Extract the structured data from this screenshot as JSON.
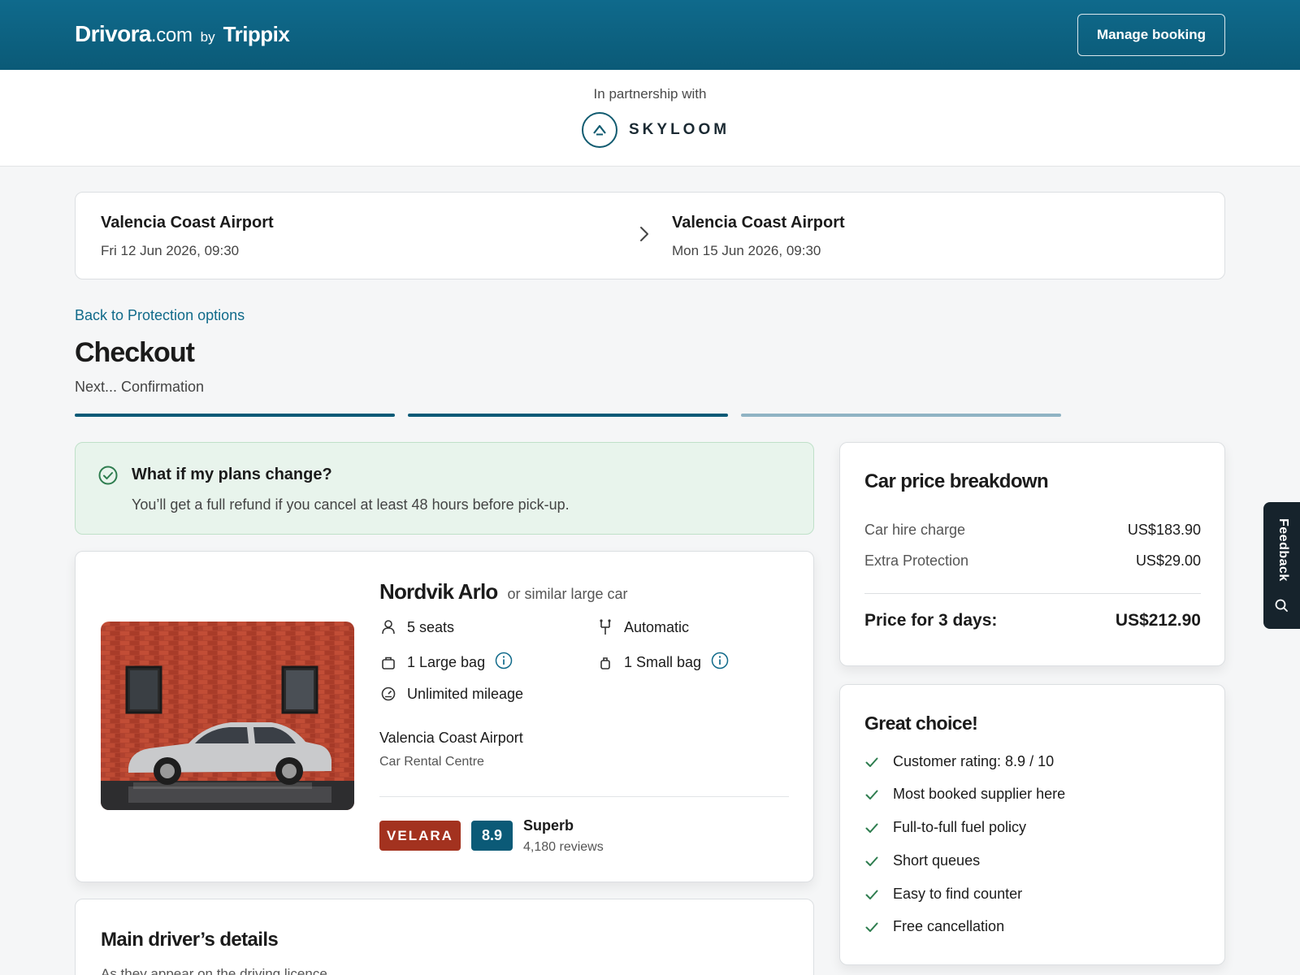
{
  "header": {
    "brand_main": "Drivora",
    "brand_domain": ".com",
    "brand_by": "by",
    "brand_partner": "Trippix",
    "manage_booking": "Manage booking"
  },
  "partnership": {
    "label": "In partnership with",
    "partner_name": "SKYLOOM"
  },
  "trip": {
    "pickup_location": "Valencia Coast Airport",
    "pickup_datetime": "Fri 12 Jun 2026, 09:30",
    "dropoff_location": "Valencia Coast Airport",
    "dropoff_datetime": "Mon 15 Jun 2026, 09:30"
  },
  "nav": {
    "back_link": "Back to Protection options"
  },
  "page": {
    "title": "Checkout",
    "next_step": "Next... Confirmation",
    "progress_steps": [
      {
        "state": "complete",
        "color": "#0b5a77"
      },
      {
        "state": "complete",
        "color": "#0b5a77"
      },
      {
        "state": "incomplete",
        "color": "#8fb3c4"
      }
    ]
  },
  "refund_notice": {
    "title": "What if my plans change?",
    "text": "You’ll get a full refund if you cancel at least 48 hours before pick-up."
  },
  "car": {
    "name": "Nordvik Arlo",
    "similar": "or similar large car",
    "features": {
      "seats": "5 seats",
      "transmission": "Automatic",
      "large_bag": "1 Large bag",
      "small_bag": "1 Small bag",
      "mileage": "Unlimited mileage"
    },
    "pickup_location": "Valencia Coast Airport",
    "pickup_sublocation": "Car Rental Centre",
    "supplier": "VELARA",
    "score": "8.9",
    "rating_word": "Superb",
    "reviews": "4,180 reviews"
  },
  "driver": {
    "title": "Main driver’s details",
    "subtitle": "As they appear on the driving licence"
  },
  "price": {
    "title": "Car price breakdown",
    "rows": [
      {
        "label": "Car hire charge",
        "value": "US$183.90"
      },
      {
        "label": "Extra Protection",
        "value": "US$29.00"
      }
    ],
    "total_label": "Price for 3 days:",
    "total_value": "US$212.90"
  },
  "great_choice": {
    "title": "Great choice!",
    "items": [
      "Customer rating: 8.9 / 10",
      "Most booked supplier here",
      "Full-to-full fuel policy",
      "Short queues",
      "Easy to find counter",
      "Free cancellation"
    ]
  },
  "feedback": {
    "label": "Feedback"
  },
  "colors": {
    "brand": "#0b5a77",
    "link": "#106a8a",
    "supplier_badge": "#a3321f",
    "success_bg": "#e8f4ec",
    "success_icon": "#2e7d4f"
  }
}
